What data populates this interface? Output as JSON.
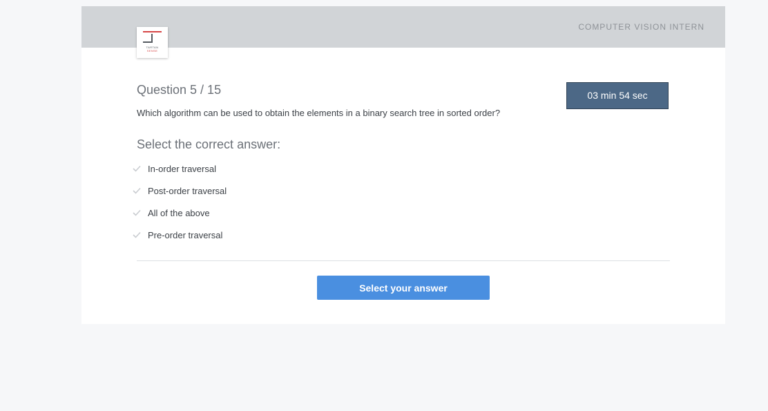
{
  "header": {
    "role": "COMPUTER VISION INTERN",
    "logo": {
      "line1": "TARTAN",
      "line2": "SENSE"
    }
  },
  "question": {
    "title": "Question 5 / 15",
    "text": "Which algorithm can be used to obtain the elements in a binary search tree in sorted order?"
  },
  "timer": {
    "label": "03 min 54 sec"
  },
  "answers": {
    "prompt": "Select the correct answer:",
    "options": [
      {
        "label": "In-order traversal"
      },
      {
        "label": "Post-order traversal"
      },
      {
        "label": "All of the above"
      },
      {
        "label": "Pre-order traversal"
      }
    ]
  },
  "submit": {
    "label": "Select your answer"
  },
  "colors": {
    "header_bg": "#d1d4d7",
    "timer_bg": "#4c6886",
    "button_bg": "#4a8fe0",
    "page_bg": "#f6f7f9"
  }
}
